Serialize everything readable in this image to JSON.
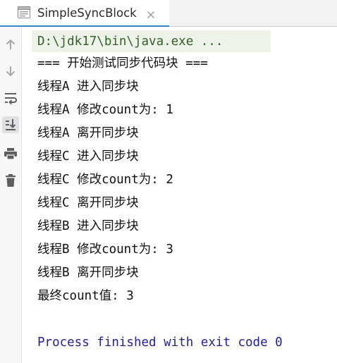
{
  "tab": {
    "title": "SimpleSyncBlock",
    "icon": "console-tab-icon"
  },
  "toolbar": {
    "items": [
      {
        "name": "rerun-up-icon"
      },
      {
        "name": "rerun-down-icon"
      },
      {
        "name": "soft-wrap-icon"
      },
      {
        "name": "scroll-to-end-icon"
      },
      {
        "name": "print-icon"
      },
      {
        "name": "clear-all-icon"
      }
    ]
  },
  "console": {
    "command": "D:\\jdk17\\bin\\java.exe ...",
    "lines": [
      "=== 开始测试同步代码块 ===",
      "线程A 进入同步块",
      "线程A 修改count为: 1",
      "线程A 离开同步块",
      "线程C 进入同步块",
      "线程C 修改count为: 2",
      "线程C 离开同步块",
      "线程B 进入同步块",
      "线程B 修改count为: 3",
      "线程B 离开同步块",
      "最终count值: 3"
    ],
    "exit_message": "Process finished with exit code 0"
  },
  "colors": {
    "command_text": "#375f2c",
    "command_background": "#edf3e9",
    "exit_text": "#23238c",
    "tab_accent": "#4083c9"
  }
}
